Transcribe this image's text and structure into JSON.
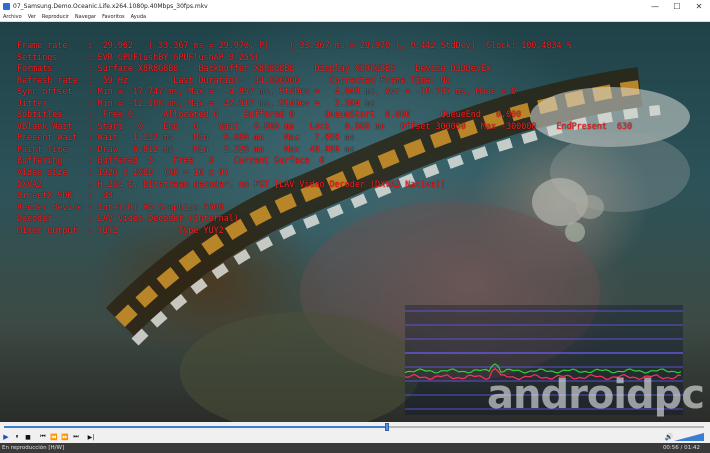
{
  "window": {
    "title": "07_Samsung.Demo.Oceanic.Life.x264.1080p.40Mbps_30fps.mkv",
    "minimize": "—",
    "maximize": "☐",
    "close": "✕"
  },
  "menu": [
    "Archivo",
    "Ver",
    "Reproducir",
    "Navegar",
    "Favoritos",
    "Ayuda"
  ],
  "stats": [
    "Frame rate    :  29.962   ( 33.367 ms = 29.970, P)    ( 33.367 ms = 29.970 ), 0.442 StdDev)  Clock: 100.4834 %",
    "Settings      : EVR GPUFlushBY GPUFlushAP 0-255)",
    "Formats       : Surface X8R8G8B8    Backbuffer X8R8G8B8    Display X8R8G8B8    Device D3DDevEx",
    "Refresh rate  :  59 Hz         Last Duration:  34.000000      Corrected Frame Time: No",
    "Sync offset   : Min = -17.747 ms, Max =  -4.857 ms, StdDev =   4.609 ms, Avr = -10.787 ms, Mode = 0",
    "Jitter        : Min = -12.108 ms, Max =  47.517 ms, StdDev =   2.304 ms",
    "Subtitles     :  Free 0      Allocated 0     Buffered 0      QueueStart  0.000      QueueEnd   0.000",
    "VBlank Wait   : Start   0    End   0    Wait   0.000 ms   Lock   0.000 ms   Offset 300000   Max -300000    EndPresent  630",
    "Present Wait  : Wait   1.122 ms    Min   0.000 ms    Max   7.898 ms",
    "Paint Time    : Draw   6.812 ms    Min   2.326 ms    Max  48.086 ms",
    "Buffering     : Buffered  5    Free   0    Current Surface  0",
    "Video size    : 1920 x 1080  (AR = 16 x 9)",
    "DXVA2         : H.264 E, bitstream decoder, no FGT [LAV Video Decoder (DXVA2 Native)]",
    "DirectX SDK   :  43",
    "Render device : Intel(R) HD Graphics 5500",
    "Decoder       : LAV Video Decoder (internal)",
    "Mixer output  : YUY2            Type YUY2"
  ],
  "watermark": "androidpc",
  "playback": {
    "progress": 0.547,
    "volume": 1.0
  },
  "controls": {
    "play": "▶",
    "pause": "⏸",
    "stop": "■",
    "prev": "⏮",
    "rewind": "⏪",
    "forward": "⏩",
    "next": "⏭",
    "frame_step": "▶|",
    "volume_icon": "🔊"
  },
  "status": {
    "text": "En reproducción [H/W]",
    "time": "00:56 / 01:42"
  },
  "colors": {
    "stats_text": "#ff2020",
    "graph_horizontal_lines": "#6a5cff",
    "graph_signal_green": "#30d030",
    "graph_signal_red": "#ff3060",
    "seek_fill": "#3c7fd0"
  }
}
